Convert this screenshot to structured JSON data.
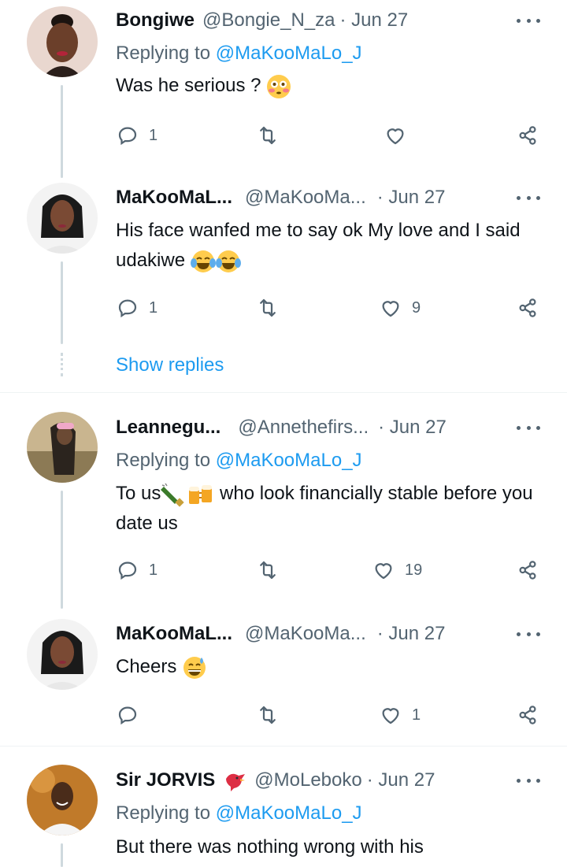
{
  "tweets": [
    {
      "name": "Bongiwe",
      "handle": "@Bongie_N_za",
      "date": "· Jun 27",
      "replying_prefix": "Replying to",
      "replying_to": "@MaKooMaLo_J",
      "text": "Was he serious ?",
      "emoji": "flushed-face",
      "replies": "1",
      "retweets": "",
      "likes": ""
    },
    {
      "name": "MaKooMaL...",
      "handle": "@MaKooMa...",
      "date": "· Jun 27",
      "text": "His face wanfed me to say ok My love and I said udakiwe",
      "emoji": "tears-of-joy x2",
      "replies": "1",
      "retweets": "",
      "likes": "9"
    },
    {
      "name": "Leannegu...",
      "handle": "@Annethefirs...",
      "date": "· Jun 27",
      "replying_prefix": "Replying to",
      "replying_to": "@MaKooMaLo_J",
      "text_before": "To us",
      "text_after": " who look financially stable before you date us",
      "emoji": "champagne, beer-mugs",
      "replies": "1",
      "retweets": "",
      "likes": "19"
    },
    {
      "name": "MaKooMaL...",
      "handle": "@MaKooMa...",
      "date": "· Jun 27",
      "text": "Cheers",
      "emoji": "grinning-sweat",
      "replies": "",
      "retweets": "",
      "likes": "1"
    },
    {
      "name": "Sir JORVIS",
      "handle": "@MoLeboko",
      "date": "· Jun 27",
      "replying_prefix": "Replying to",
      "replying_to": "@MaKooMaLo_J",
      "text": "But there was nothing wrong with his",
      "emoji": "red-bird"
    }
  ],
  "show_replies": "Show replies",
  "colors": {
    "accent": "#1d9bf0",
    "muted": "#536471",
    "text": "#0f1419",
    "line": "#cfd9de"
  }
}
